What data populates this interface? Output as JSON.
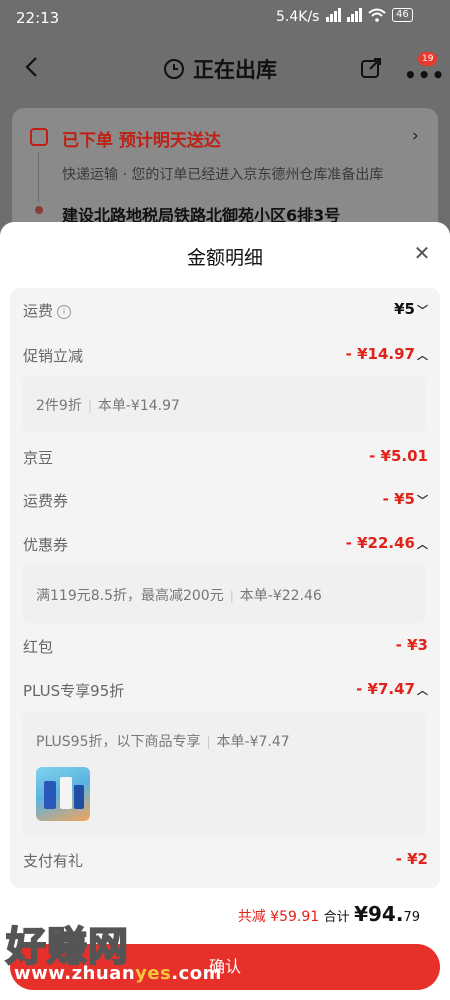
{
  "status_bar": {
    "time": "22:13",
    "speed": "5.4K/s",
    "battery": "46"
  },
  "nav": {
    "title": "正在出库",
    "badge": "19"
  },
  "order": {
    "status": "已下单  预计明天送达",
    "description": "快递运输 · 您的订单已经进入京东德州仓库准备出库",
    "address": "建设北路地税局铁路北御苑小区6排3号"
  },
  "sheet": {
    "title": "金额明细",
    "rows": {
      "freight": {
        "label": "运费",
        "value": "¥5"
      },
      "promo": {
        "label": "促销立减",
        "value": "- ¥14.97"
      },
      "promo_detail": {
        "rule": "2件9折",
        "this_order": "本单-¥14.97"
      },
      "jingdou": {
        "label": "京豆",
        "value": "- ¥5.01"
      },
      "freight_coupon": {
        "label": "运费券",
        "value": "- ¥5"
      },
      "coupon": {
        "label": "优惠券",
        "value": "- ¥22.46"
      },
      "coupon_detail": {
        "rule": "满119元8.5折，最高减200元",
        "this_order": "本单-¥22.46"
      },
      "hongbao": {
        "label": "红包",
        "value": "- ¥3"
      },
      "plus": {
        "label": "PLUS专享95折",
        "value": "- ¥7.47"
      },
      "plus_detail": {
        "rule": "PLUS95折，以下商品专享",
        "this_order": "本单-¥7.47"
      },
      "gift": {
        "label": "支付有礼",
        "value": "- ¥2"
      }
    }
  },
  "summary": {
    "saved_label": "共减",
    "saved_value": "¥59.91",
    "total_label": "合计",
    "total_int": "¥94.",
    "total_dec": "79"
  },
  "confirm_label": "确认",
  "watermark": {
    "text": "好赚网",
    "url_pre": "www.zhuan",
    "url_mid": "yes",
    "url_post": ".com"
  },
  "colors": {
    "accent": "#e2231a",
    "button": "#e8302a"
  },
  "icons": [
    "back-icon",
    "clock-icon",
    "share-icon",
    "more-icon",
    "close-icon",
    "info-icon",
    "chevron-down-icon",
    "chevron-up-icon"
  ]
}
